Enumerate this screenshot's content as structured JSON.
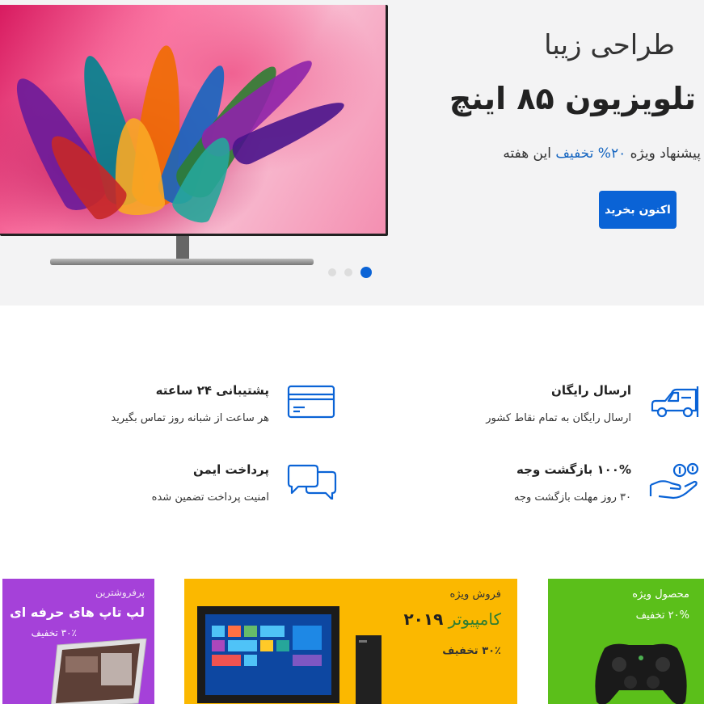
{
  "hero": {
    "subtitle": "طراحی زیبا",
    "title": "تلویزیون ۸۵ اینچ",
    "offer_before": "پیشنهاد ویژه ",
    "offer_highlight": "۲۰% تخفیف",
    "offer_after": " این هفته",
    "cta_label": "اکنون بخرید",
    "slides_total": 3,
    "active_slide": 1
  },
  "features": [
    {
      "title": "ارسال رایگان",
      "desc": "ارسال رایگان به تمام نقاط کشور",
      "icon": "truck-icon"
    },
    {
      "title": "پشتیبانی ۲۴ ساعته",
      "desc": "هر ساعت از شبانه روز تماس بگیرید",
      "icon": "credit-card-icon"
    },
    {
      "title": "۱۰۰% بازگشت وجه",
      "desc": "۳۰ روز مهلت بازگشت وجه",
      "icon": "money-back-hand-icon"
    },
    {
      "title": "پرداخت ایمن",
      "desc": "امنیت پرداخت تضمین شده",
      "icon": "chat-bubbles-icon"
    }
  ],
  "promos": {
    "laptop": {
      "tag": "پرفروشترین",
      "title": "لپ تاپ های حرفه ای",
      "discount": "۳۰٪ تخفیف",
      "color": "#a541d9"
    },
    "computer": {
      "tag": "فروش ویژه",
      "title_highlight": "کامپیوتر",
      "title_year": "۲۰۱۹",
      "discount": "۳۰٪ تخفیف",
      "color": "#fbb800"
    },
    "gamepad": {
      "tag": "محصول ویژه",
      "discount": "۲۰% تخفیف",
      "color": "#5bbf1a"
    }
  },
  "colors": {
    "primary": "#0a63d6",
    "hero_bg": "#f3f3f4"
  }
}
